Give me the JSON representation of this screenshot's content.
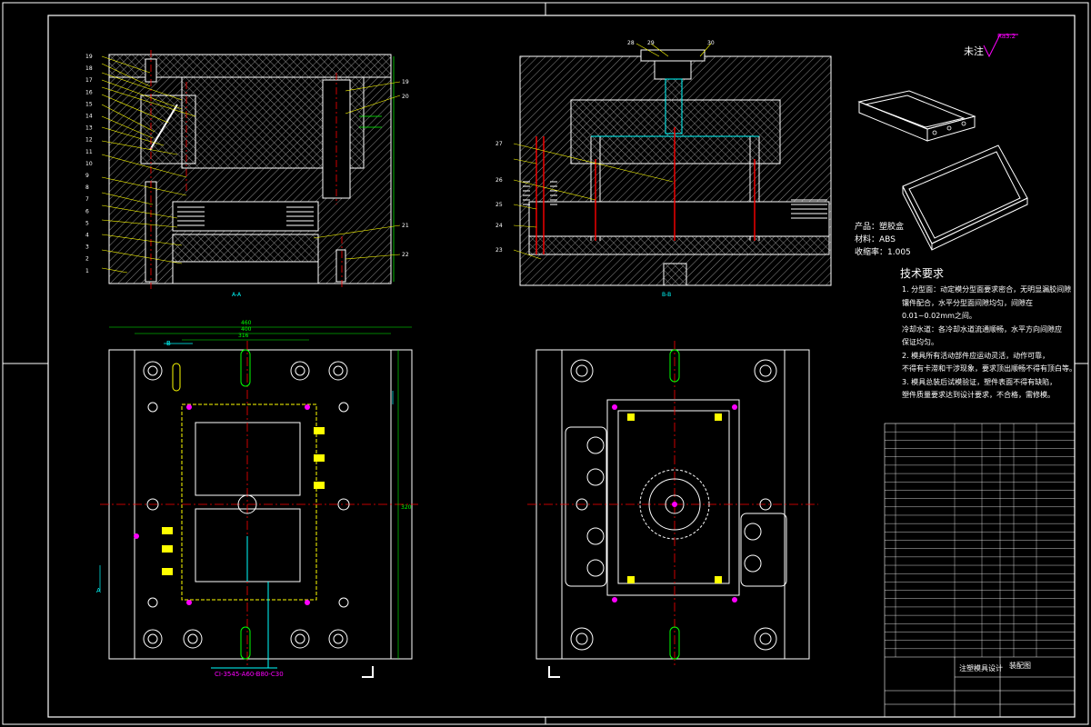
{
  "drawing": {
    "colors": {
      "background": "#000000",
      "frame": "#ffffff",
      "section_outline": "#ffffff",
      "hatch": "#8a8a8a",
      "leader": "#ffff00",
      "centerline": "#ff0000",
      "dimension": "#00ff00",
      "hidden_line": "#ffff00",
      "balloon": "#ff00ff",
      "cooling_channel": "#00ffff",
      "detail": "#00ffff"
    },
    "roughness": {
      "label": "未注",
      "value": "Ra3.2"
    },
    "section_labels": {
      "left": "A-A",
      "right": "B-B"
    },
    "view_letters": {
      "b": "B",
      "a": "A"
    },
    "balloons_left": [
      "19",
      "18",
      "17",
      "16",
      "15",
      "14",
      "13",
      "12",
      "11",
      "10",
      "9",
      "8",
      "7",
      "6",
      "5",
      "4",
      "3",
      "2",
      "1"
    ],
    "balloons_left_right": [
      "19",
      "20",
      "21",
      "22"
    ],
    "balloons_top_right": [
      "28",
      "29",
      "30"
    ],
    "balloons_right": [
      "27",
      "26",
      "25",
      "24",
      "23"
    ],
    "product": {
      "name_label": "产品：",
      "name_value": "塑胶盒",
      "material_label": "材料：",
      "material_value": "ABS",
      "shrink_label": "收缩率：",
      "shrink_value": "1.005"
    },
    "tech": {
      "title": "技术要求",
      "lines": [
        "1. 分型面：动定模分型面要求密合，无明显漏胶间隙",
        "镶件配合，水平分型面间隙均匀，间隙在",
        "0.01~0.02mm之间。",
        "冷却水道：各冷却水道流通顺畅，水平方向间隙应",
        "保证均匀。",
        "2. 模具所有活动部件应运动灵活，动作可靠，",
        "不得有卡滞和干涉现象，要求顶出顺畅不得有顶白等。",
        "3. 模具总装后试模验证，塑件表面不得有缺陷，",
        "塑件质量要求达到设计要求，不合格，需修模。"
      ]
    },
    "dim_labels": [
      "460",
      "400",
      "316",
      "320"
    ],
    "bottom_text": "CI-3545-A60-B80-C30",
    "title_block": {
      "drawing_title": "注塑模具设计",
      "assembly": "装配图",
      "row_count": 28
    }
  }
}
